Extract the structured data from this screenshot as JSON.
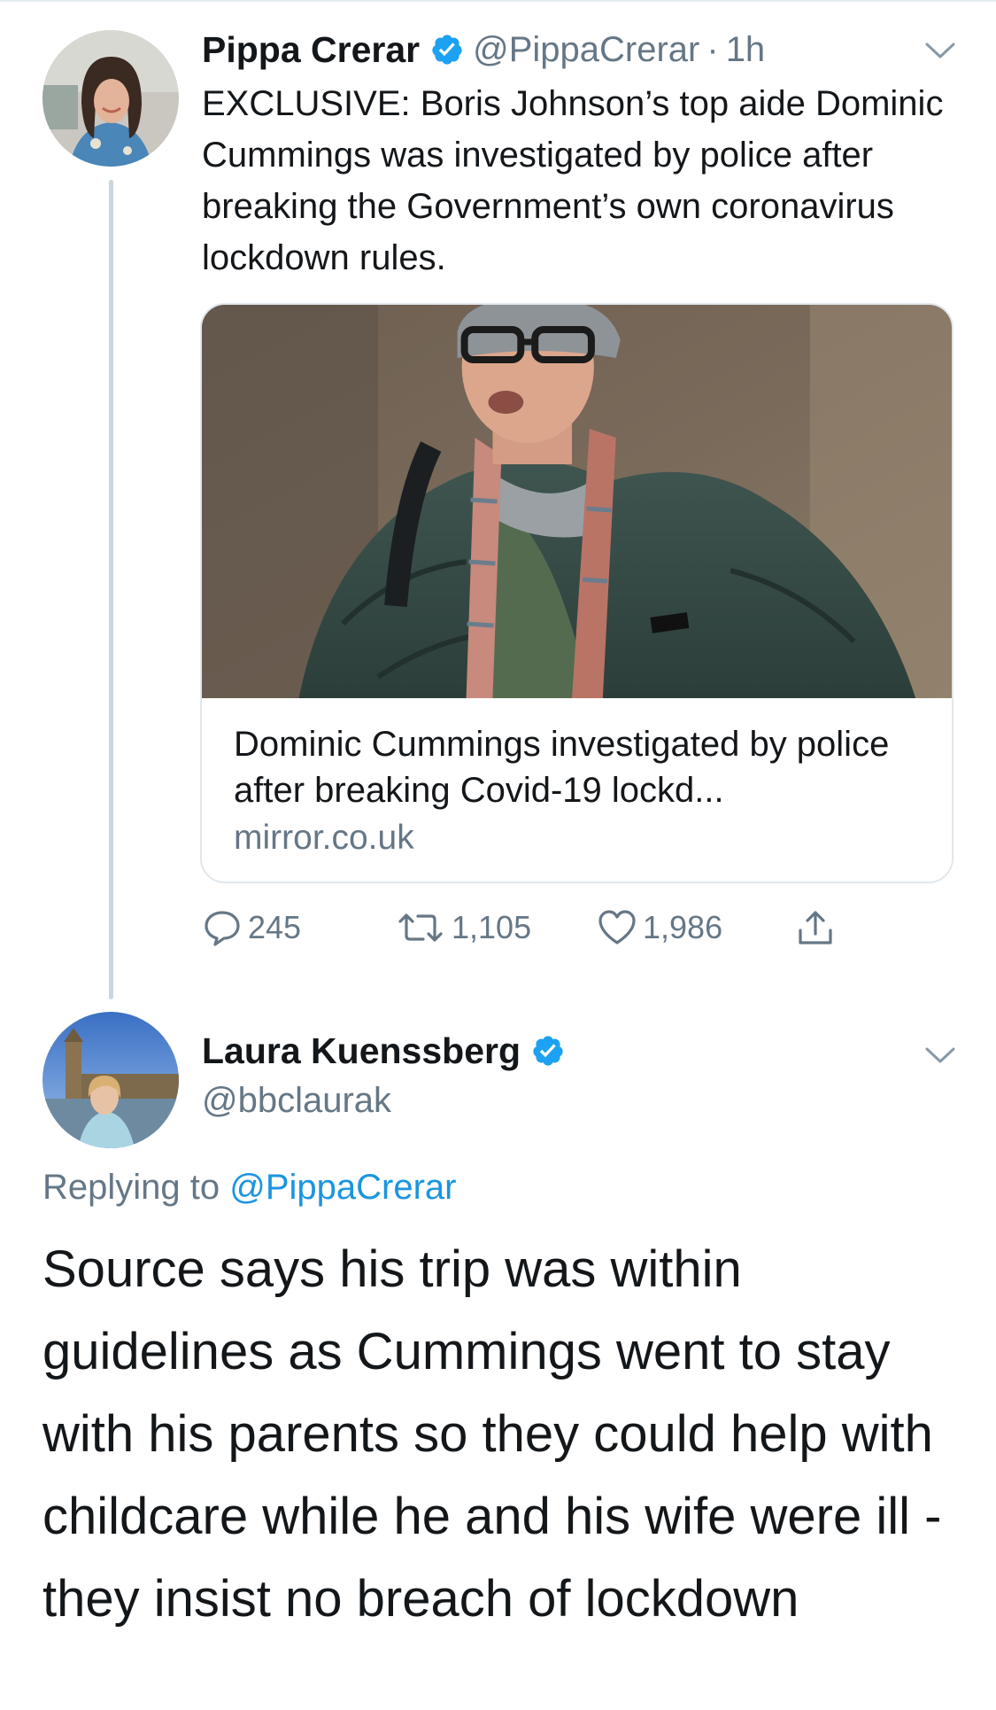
{
  "tweet1": {
    "author_name": "Pippa Crerar",
    "handle": "@PippaCrerar",
    "separator": "·",
    "time": "1h",
    "text": "EXCLUSIVE: Boris Johnson’s top aide Dominic Cummings was investigated by police after breaking the Government’s own coronavirus lockdown rules.",
    "card": {
      "title": "Dominic Cummings investigated by police after breaking Covid-19 lockd...",
      "domain": "mirror.co.uk"
    },
    "actions": {
      "replies": "245",
      "retweets": "1,105",
      "likes": "1,986"
    }
  },
  "tweet2": {
    "author_name": "Laura Kuenssberg",
    "handle": "@bbclaurak",
    "replying_prefix": "Replying to",
    "replying_to": "@PippaCrerar",
    "text": "Source says his trip was within guidelines as Cummings went to stay with his parents so they could help with childcare while he and his wife were ill - they insist no breach of lockdown"
  },
  "icons": {
    "verified": "verified-badge-icon",
    "more": "chevron-down-icon",
    "reply": "reply-bubble-icon",
    "retweet": "retweet-icon",
    "like": "heart-icon",
    "share": "share-icon"
  },
  "colors": {
    "verified_blue": "#1da1f2",
    "link_blue": "#1b95e0",
    "secondary_text": "#657786",
    "thread_line": "#cbd5dc",
    "card_border": "#e1e8ed"
  }
}
